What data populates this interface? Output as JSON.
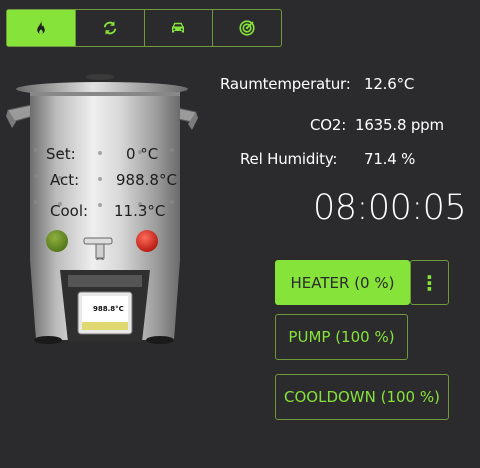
{
  "tabs": [
    {
      "icon": "flame-icon",
      "active": true
    },
    {
      "icon": "refresh-icon",
      "active": false
    },
    {
      "icon": "car-icon",
      "active": false
    },
    {
      "icon": "radar-icon",
      "active": false
    }
  ],
  "kettle": {
    "set_label": "Set:",
    "set_value": "0 °C",
    "act_label": "Act:",
    "act_value": "988.8°C",
    "cool_label": "Cool:",
    "cool_value": "11.3°C",
    "display_value": "988.8°C",
    "colors": {
      "left_indicator": "#5f8a22",
      "right_indicator": "#d8261a"
    }
  },
  "sensors": {
    "room_label": "Raumtemperatur:",
    "room_value": "12.6°C",
    "co2_label": "CO2:",
    "co2_value": "1635.8 ppm",
    "humidity_label": "Rel Humidity:",
    "humidity_value": "71.4 %"
  },
  "clock": "08:00:05",
  "buttons": {
    "heater": "HEATER (0 %)",
    "heater_menu": "⋮",
    "pump": "PUMP (100 %)",
    "cooldown": "COOLDOWN (100 %)"
  },
  "colors": {
    "accent": "#86e33a",
    "background": "#2b2a2c"
  }
}
